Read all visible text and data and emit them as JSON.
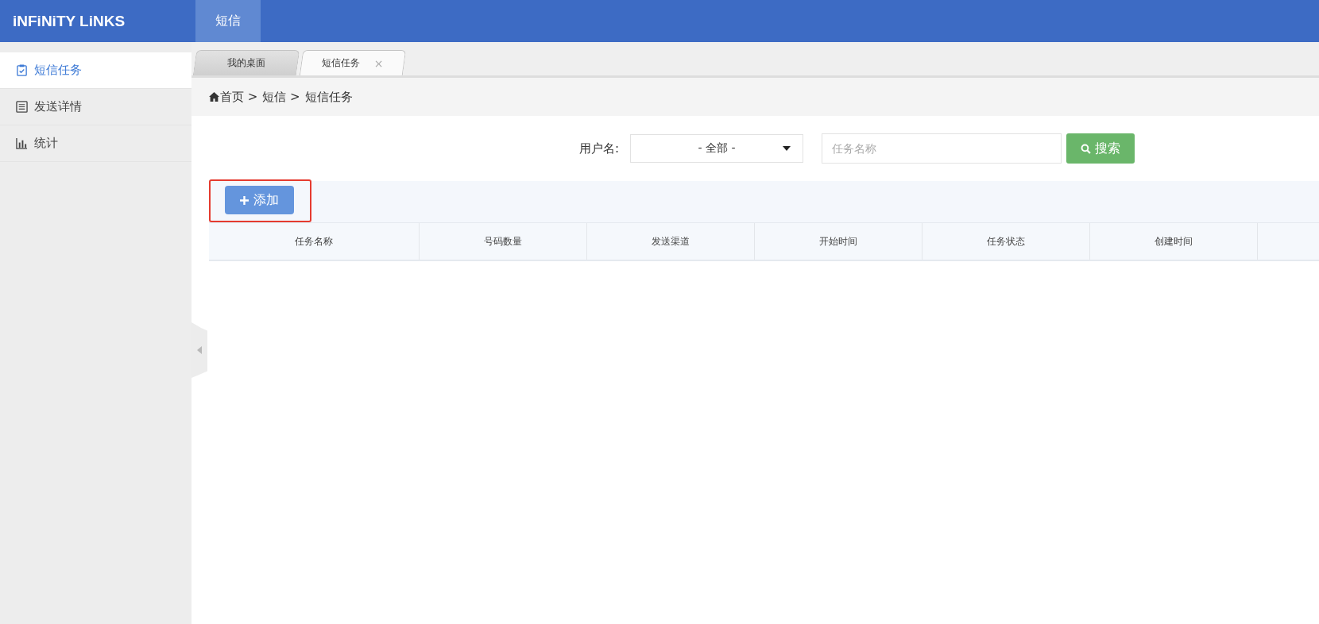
{
  "header": {
    "logo": "iNFiNiTY LiNKS",
    "nav": [
      {
        "label": "短信",
        "selected": true
      }
    ]
  },
  "sidebar": {
    "items": [
      {
        "label": "短信任务",
        "kind": "task",
        "selected": true
      },
      {
        "label": "发送详情",
        "kind": "detail",
        "selected": false
      },
      {
        "label": "统计",
        "kind": "stats",
        "selected": false
      }
    ]
  },
  "tabs": [
    {
      "label": "我的桌面",
      "selected": false
    },
    {
      "label": "短信任务",
      "selected": true,
      "close": "×"
    }
  ],
  "breadcrumb": [
    "首页 >",
    "短信 >",
    "短信任务"
  ],
  "filter": {
    "user_label": "用户名:",
    "user_value": "- 全部 -",
    "task_placeholder": "任务名称",
    "search": "搜索"
  },
  "add_button": {
    "label": "添加",
    "highlighted": true
  },
  "table": {
    "columns": [
      "任务名称",
      "号码数量",
      "发送渠道",
      "开始时间",
      "任务状态",
      "创建时间"
    ]
  }
}
